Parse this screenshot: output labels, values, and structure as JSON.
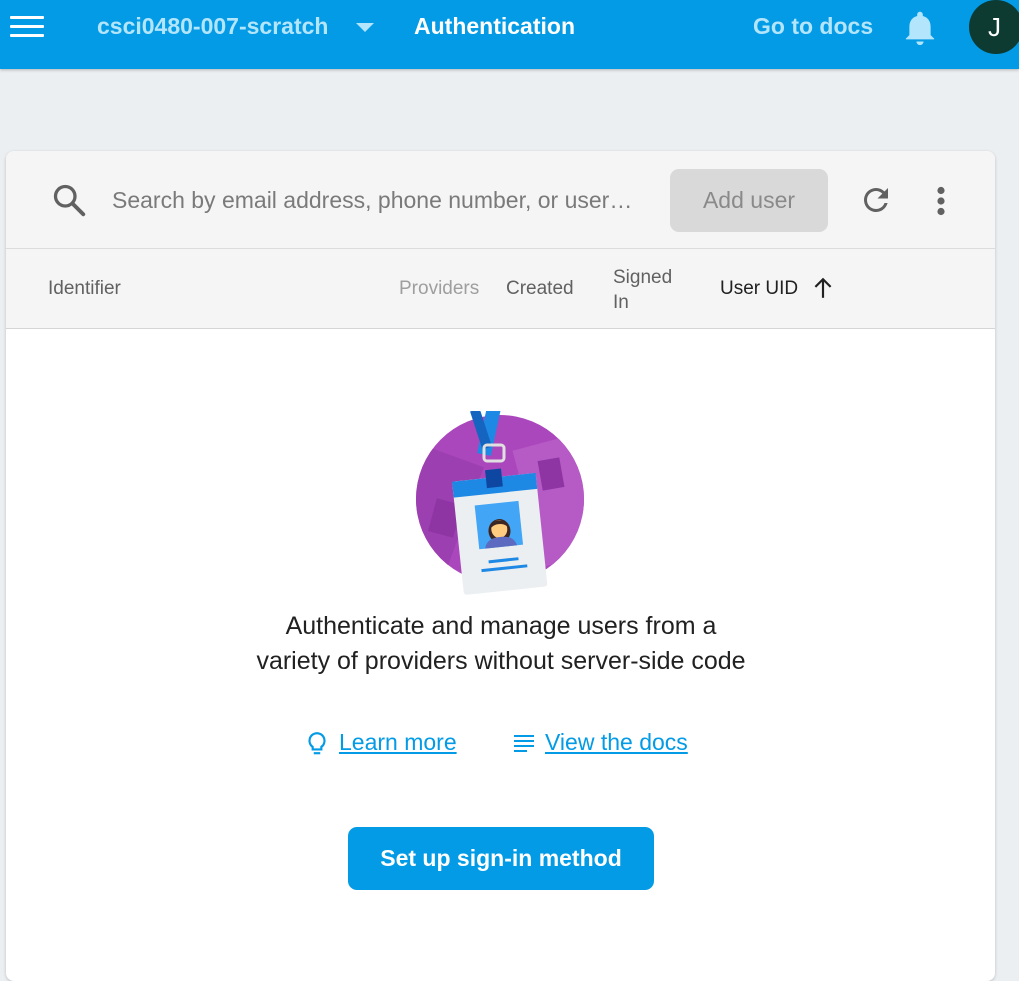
{
  "header": {
    "project_name": "csci0480-007-scratch",
    "section_title": "Authentication",
    "docs_label": "Go to docs",
    "avatar_initial": "J"
  },
  "search": {
    "placeholder": "Search by email address, phone number, or user…",
    "value": ""
  },
  "toolbar": {
    "add_user_label": "Add user"
  },
  "table": {
    "columns": [
      "Identifier",
      "Providers",
      "Created",
      "Signed In",
      "User UID"
    ],
    "sort_column": "User UID",
    "sort_direction": "ascending"
  },
  "empty_state": {
    "message": "Authenticate and manage users from a variety of providers without server-side code",
    "learn_more_label": "Learn more",
    "view_docs_label": "View the docs",
    "cta_label": "Set up sign-in method"
  },
  "icons": [
    "menu-icon",
    "dropdown-caret-icon",
    "bell-icon",
    "search-icon",
    "refresh-icon",
    "more-vert-icon",
    "arrow-up-icon",
    "lightbulb-icon",
    "docs-lines-icon",
    "id-badge-illustration"
  ],
  "colors": {
    "primary": "#039be5",
    "header_text_muted": "#b3e5fc",
    "avatar_bg": "#0d3b32",
    "page_bg": "#eceff1",
    "disabled_button": "#d9d9d9"
  }
}
